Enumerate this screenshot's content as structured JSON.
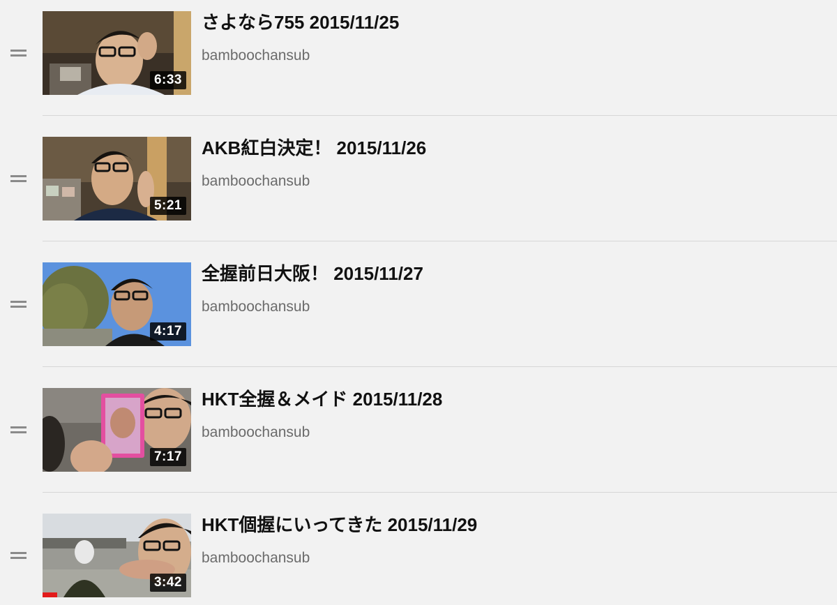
{
  "playlist": {
    "items": [
      {
        "title": "さよなら755 2015/11/25",
        "channel": "bamboochansub",
        "duration": "6:33",
        "watched_fraction": 0
      },
      {
        "title": "AKB紅白決定！ 2015/11/26",
        "channel": "bamboochansub",
        "duration": "5:21",
        "watched_fraction": 0
      },
      {
        "title": "全握前日大阪！ 2015/11/27",
        "channel": "bamboochansub",
        "duration": "4:17",
        "watched_fraction": 0
      },
      {
        "title": "HKT全握＆メイド 2015/11/28",
        "channel": "bamboochansub",
        "duration": "7:17",
        "watched_fraction": 0
      },
      {
        "title": "HKT個握にいってきた 2015/11/29",
        "channel": "bamboochansub",
        "duration": "3:42",
        "watched_fraction": 0.1
      }
    ]
  },
  "icons": {
    "drag_handle": "drag-handle-icon"
  },
  "colors": {
    "background": "#f2f2f2",
    "title_text": "#111111",
    "channel_text": "#6b6b6b",
    "progress": "#e21b1b",
    "duration_bg": "#000000"
  }
}
